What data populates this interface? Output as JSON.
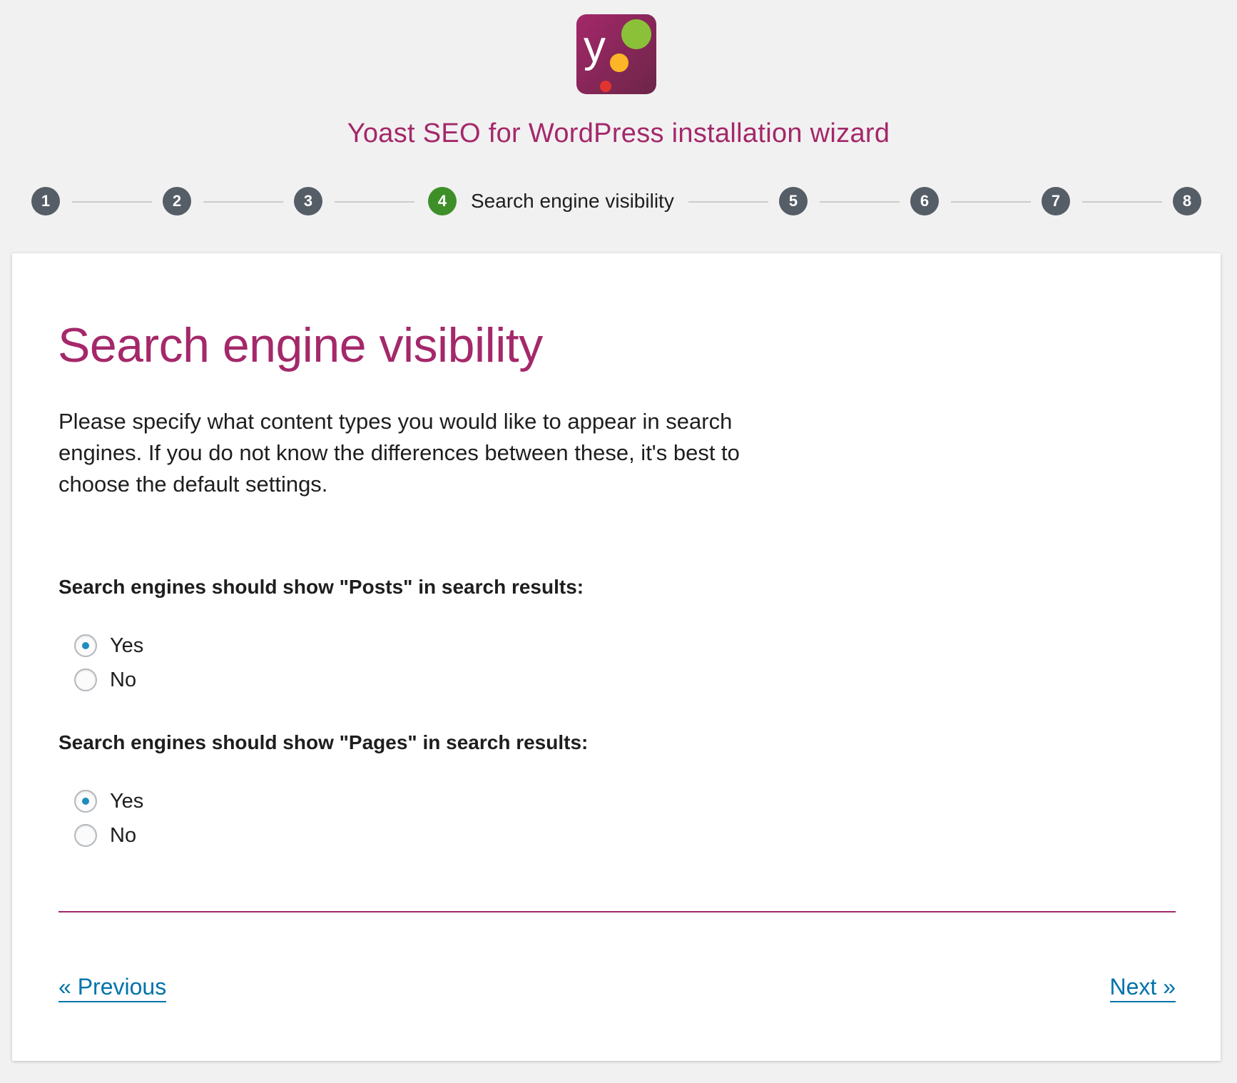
{
  "header": {
    "logo_icon": "yoast-logo-icon",
    "title": "Yoast SEO for WordPress installation wizard"
  },
  "stepper": {
    "steps": [
      {
        "number": "1",
        "active": false
      },
      {
        "number": "2",
        "active": false
      },
      {
        "number": "3",
        "active": false
      },
      {
        "number": "4",
        "active": true,
        "label": "Search engine visibility"
      },
      {
        "number": "5",
        "active": false
      },
      {
        "number": "6",
        "active": false
      },
      {
        "number": "7",
        "active": false
      },
      {
        "number": "8",
        "active": false
      }
    ]
  },
  "main": {
    "title": "Search engine visibility",
    "intro": "Please specify what content types you would like to appear in search engines. If you do not know the differences between these, it's best to choose the default settings.",
    "questions": [
      {
        "label": "Search engines should show \"Posts\" in search results:",
        "options": [
          {
            "label": "Yes",
            "checked": true
          },
          {
            "label": "No",
            "checked": false
          }
        ]
      },
      {
        "label": "Search engines should show \"Pages\" in search results:",
        "options": [
          {
            "label": "Yes",
            "checked": true
          },
          {
            "label": "No",
            "checked": false
          }
        ]
      }
    ]
  },
  "footer": {
    "previous_label": "« Previous",
    "next_label": "Next »"
  },
  "colors": {
    "brand": "#a4286a",
    "step_inactive": "#555d66",
    "step_active": "#3f8f29",
    "link": "#0073aa",
    "radio_dot": "#1e8cbe",
    "background": "#f1f1f1"
  }
}
